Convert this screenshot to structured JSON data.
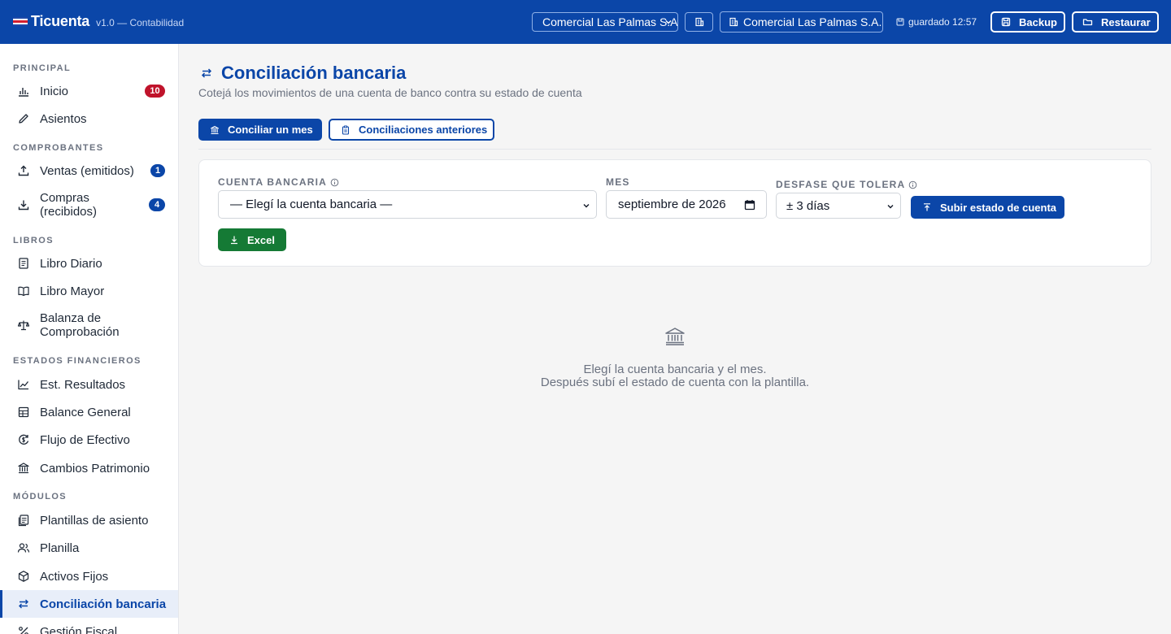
{
  "app": {
    "name": "Ticuenta",
    "version": "v1.0 — Contabilidad",
    "company_select": "Comercial Las Palmas S.A.",
    "company_name": "Comercial Las Palmas S.A.",
    "saved_status": "guardado 12:57",
    "backup_label": "Backup",
    "restore_label": "Restaurar",
    "brand_color": "#0b46a8"
  },
  "sidebar": {
    "sections": {
      "principal": "PRINCIPAL",
      "comprobantes": "COMPROBANTES",
      "libros": "LIBROS",
      "estados": "ESTADOS FINANCIEROS",
      "modulos": "MÓDULOS"
    },
    "items": [
      {
        "label": "Inicio",
        "icon": "bar-chart-icon",
        "badge": "10",
        "badge_color": "#c0132b"
      },
      {
        "label": "Asientos",
        "icon": "pencil-icon"
      },
      {
        "label": "Ventas (emitidos)",
        "icon": "upload-icon",
        "badge": "1",
        "badge_color": "#0b46a8"
      },
      {
        "label": "Compras (recibidos)",
        "icon": "download-icon",
        "badge": "4",
        "badge_color": "#0b46a8"
      },
      {
        "label": "Libro Diario",
        "icon": "journal-icon"
      },
      {
        "label": "Libro Mayor",
        "icon": "book-open-icon"
      },
      {
        "label": "Balanza de Comprobación",
        "icon": "scale-icon"
      },
      {
        "label": "Est. Resultados",
        "icon": "line-chart-icon"
      },
      {
        "label": "Balance General",
        "icon": "table-icon"
      },
      {
        "label": "Flujo de Efectivo",
        "icon": "cash-flow-icon"
      },
      {
        "label": "Cambios Patrimonio",
        "icon": "bank-icon"
      },
      {
        "label": "Plantillas de asiento",
        "icon": "template-icon"
      },
      {
        "label": "Planilla",
        "icon": "users-icon"
      },
      {
        "label": "Activos Fijos",
        "icon": "box-icon"
      },
      {
        "label": "Conciliación bancaria",
        "icon": "swap-icon",
        "active": true
      },
      {
        "label": "Gestión Fiscal",
        "icon": "percent-icon"
      }
    ]
  },
  "main": {
    "title": "Conciliación bancaria",
    "subtitle": "Cotejá los movimientos de una cuenta de banco contra su estado de cuenta",
    "tabs": [
      "Conciliar un mes",
      "Conciliaciones anteriores"
    ],
    "form": {
      "account_label": "CUENTA BANCARIA",
      "account_value": "— Elegí la cuenta bancaria —",
      "month_label": "MES",
      "month_value": "septiembre de 2026",
      "tolerance_label": "DESFASE QUE TOLERA",
      "tolerance_value": "± 3 días",
      "upload_label": "Subir estado de cuenta",
      "excel_label": "Excel"
    },
    "empty_state": {
      "line1": "Elegí la cuenta bancaria y el mes.",
      "line2": "Después subí el estado de cuenta con la plantilla."
    }
  }
}
